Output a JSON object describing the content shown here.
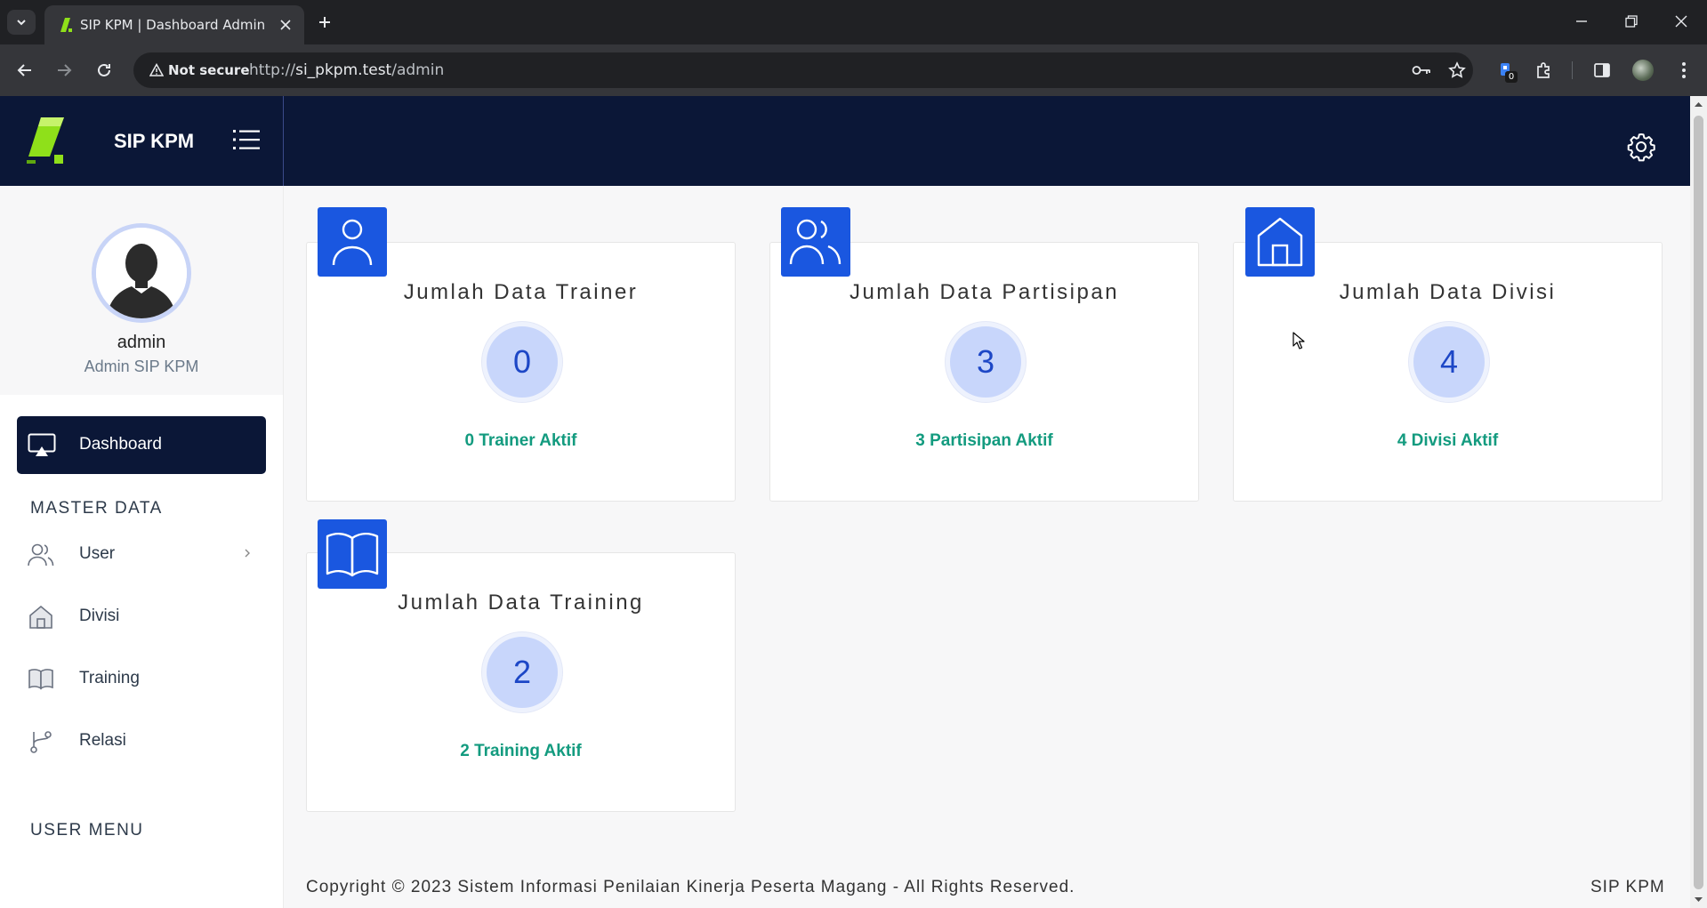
{
  "browser": {
    "tab_title": "SIP KPM | Dashboard Admin",
    "security_label": "Not secure",
    "url_scheme": "http://",
    "url_host": "si_pkpm.test",
    "url_path": "/admin",
    "extension_badge": "0"
  },
  "header": {
    "brand_name": "SIP KPM"
  },
  "sidebar": {
    "user_name": "admin",
    "user_role": "Admin SIP KPM",
    "active_item": "Dashboard",
    "section_master": "MASTER DATA",
    "section_user_menu": "USER MENU",
    "items": [
      {
        "label": "User"
      },
      {
        "label": "Divisi"
      },
      {
        "label": "Training"
      },
      {
        "label": "Relasi"
      }
    ]
  },
  "cards": [
    {
      "title": "Jumlah Data Trainer",
      "count": "0",
      "footer": "0 Trainer Aktif",
      "icon": "user-icon"
    },
    {
      "title": "Jumlah Data Partisipan",
      "count": "3",
      "footer": "3 Partisipan Aktif",
      "icon": "users-icon"
    },
    {
      "title": "Jumlah Data Divisi",
      "count": "4",
      "footer": "4 Divisi Aktif",
      "icon": "home-icon"
    },
    {
      "title": "Jumlah Data Training",
      "count": "2",
      "footer": "2 Training Aktif",
      "icon": "book-icon"
    }
  ],
  "footer": {
    "copyright": "Copyright © 2023 Sistem Informasi Penilaian Kinerja Peserta Magang - All Rights Reserved.",
    "brand": "SIP KPM"
  },
  "colors": {
    "navy": "#0b1737",
    "accent_blue": "#1a57e0",
    "teal": "#139b7f",
    "logo_green": "#8fe01a"
  }
}
